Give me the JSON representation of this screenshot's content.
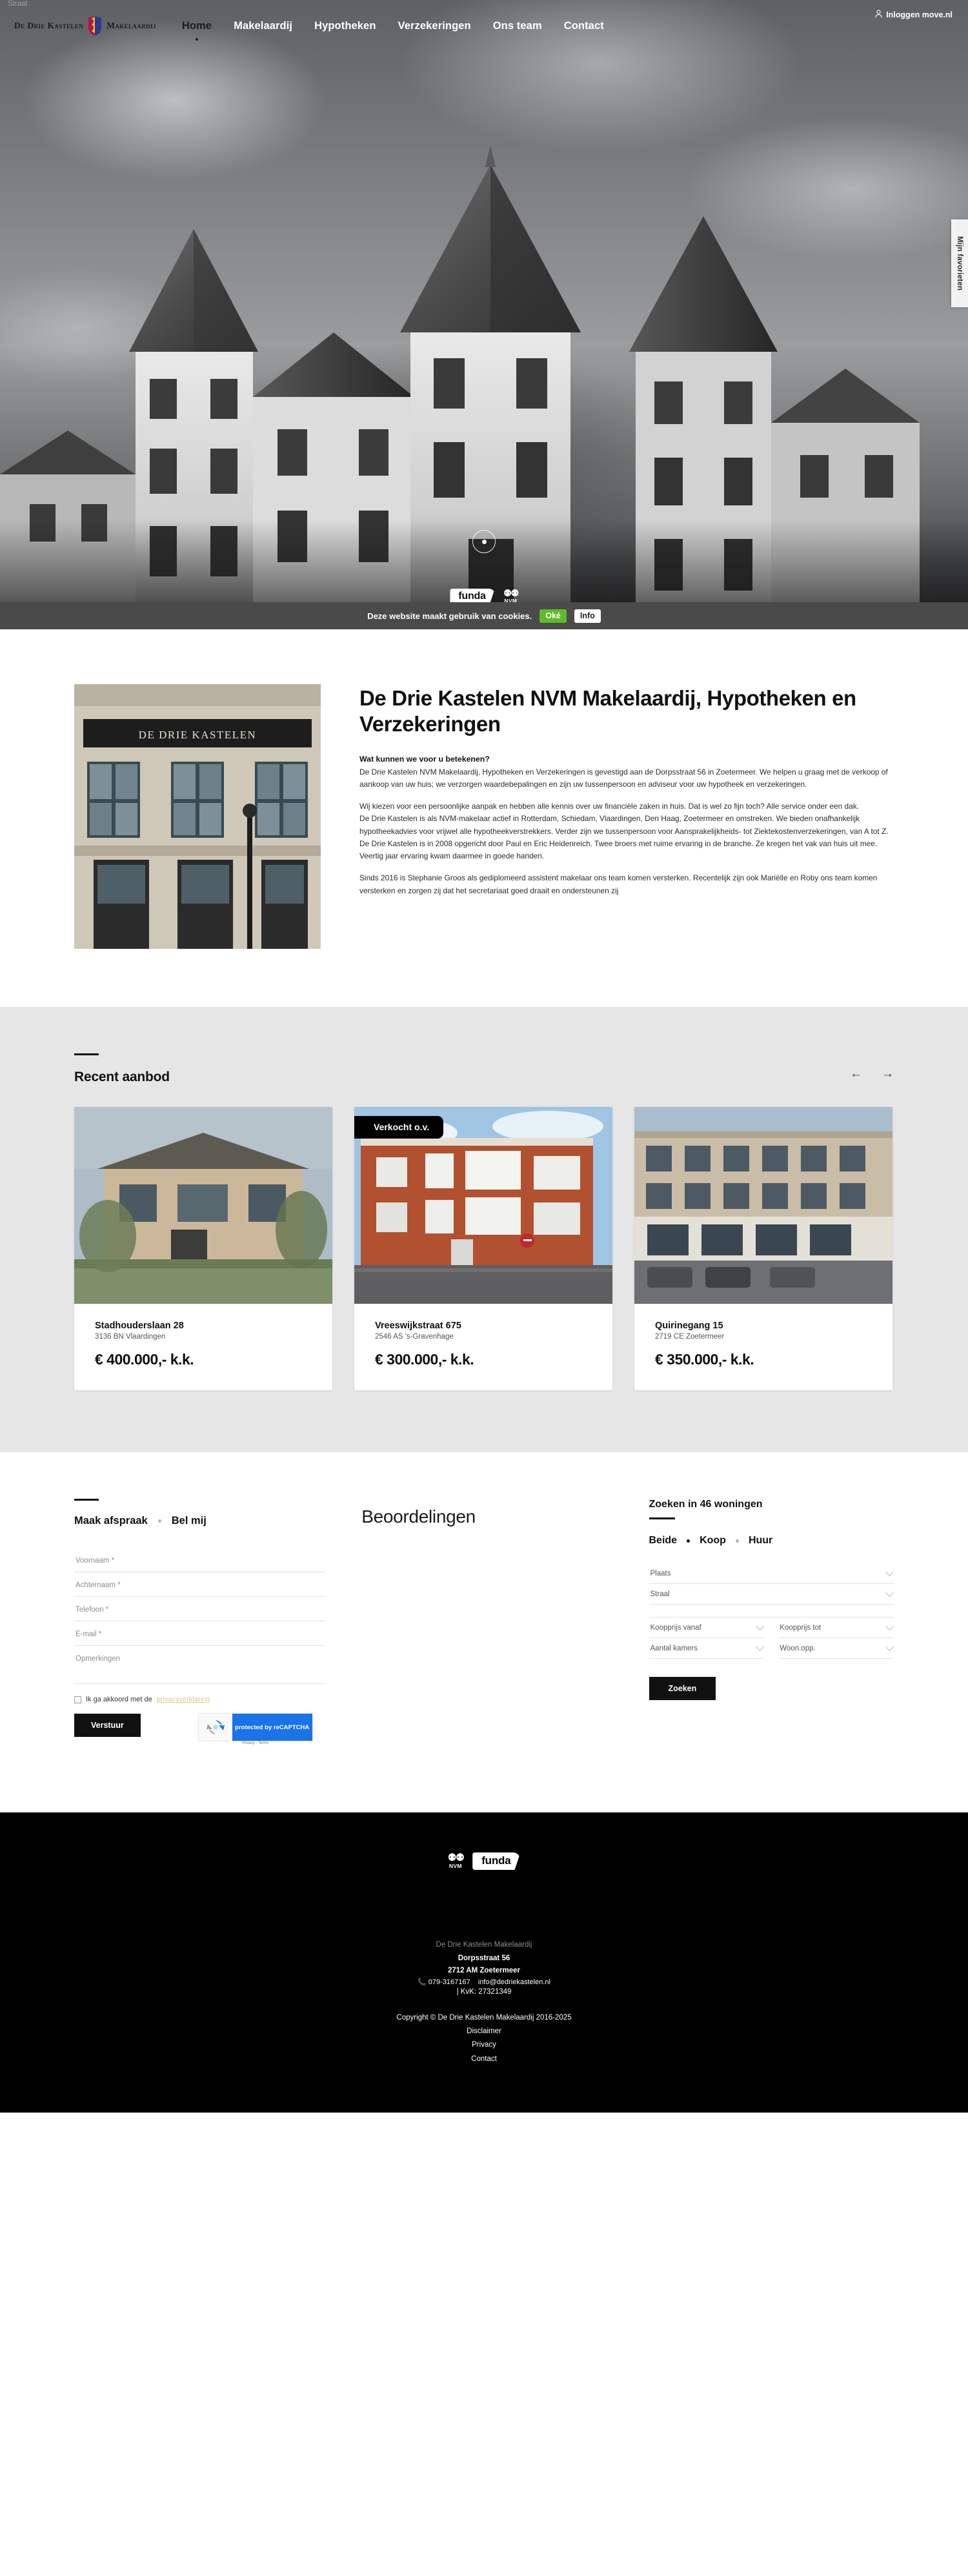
{
  "nav": {
    "logo_left": "De Drie Kastelen",
    "logo_right": "Makelaardij",
    "links": [
      {
        "label": "Home",
        "active": true
      },
      {
        "label": "Makelaardij",
        "active": false
      },
      {
        "label": "Hypotheken",
        "active": false
      },
      {
        "label": "Verzekeringen",
        "active": false
      },
      {
        "label": "Ons team",
        "active": false
      },
      {
        "label": "Contact",
        "active": false
      }
    ],
    "login_label": "Inloggen move.nl",
    "favorites_tab": "Mijn favorieten"
  },
  "hero": {
    "funda_badge": "funda",
    "nvm_badge": "NVM"
  },
  "cookie": {
    "message": "Deze website maakt gebruik van cookies.",
    "accept_label": "Oké",
    "info_label": "Info",
    "accept_color": "#5fbb27"
  },
  "about": {
    "title": "De Drie Kastelen NVM Makelaardij, Hypotheken en Verzekeringen",
    "lead": "Wat kunnen we voor u betekenen?",
    "paragraphs": [
      "De Drie Kastelen NVM Makelaardij, Hypotheken en Verzekeringen is gevestigd aan de Dorpsstraat 56 in Zoetermeer. We helpen u graag met de verkoop of aankoop van uw huis; we verzorgen waardebepalingen en zijn uw tussenpersoon en adviseur voor uw hypotheek en verzekeringen.",
      "Wij kiezen voor een persoonlijke aanpak en hebben alle kennis over uw financiële zaken in huis. Dat is wel zo fijn toch? Alle service onder een dak.\nDe Drie Kastelen is als NVM-makelaar actief in Rotterdam, Schiedam, Vlaardingen, Den Haag,  Zoetermeer en omstreken. We bieden onafhankelijk hypotheekadvies voor vrijwel alle hypotheekverstrekkers. Verder zijn we tussenpersoon voor Aansprakelijkheids-  tot Ziektekostenverzekeringen, van A tot Z.\nDe Drie Kastelen is in 2008 opgericht door Paul en Eric Heidenreich. Twee broers met ruime ervaring in de branche. Ze kregen het vak van huis uit mee. Veertig jaar ervaring kwam daarmee in goede handen.",
      "Sinds 2016 is Stephanie Groos als gediplomeerd assistent makelaar ons team komen versterken. Recentelijk zijn ook Mariëlle en Roby ons team komen versterken en zorgen zij dat het secretariaat goed draait en ondersteunen zij"
    ],
    "photo_sign": "DE DRIE KASTELEN"
  },
  "aanbod": {
    "title": "Recent aanbod",
    "prev_icon": "arrow-left-icon",
    "next_icon": "arrow-right-icon",
    "cards": [
      {
        "address": "Stadhouderslaan 28",
        "zip": "3136 BN Vlaardingen",
        "price": "€ 400.000,- k.k.",
        "badge": ""
      },
      {
        "address": "Vreeswijkstraat 675",
        "zip": "2546 AS 's-Gravenhage",
        "price": "€ 300.000,- k.k.",
        "badge": "Verkocht o.v."
      },
      {
        "address": "Quirinegang 15",
        "zip": "2719 CE Zoetermeer",
        "price": "€ 350.000,- k.k.",
        "badge": ""
      }
    ]
  },
  "contact": {
    "tab_appointment": "Maak afspraak",
    "tab_call": "Bel mij",
    "fields": [
      {
        "placeholder": "Voornaam *",
        "value": ""
      },
      {
        "placeholder": "Achternaam *",
        "value": ""
      },
      {
        "placeholder": "Telefoon *",
        "value": ""
      },
      {
        "placeholder": "E-mail *",
        "value": ""
      },
      {
        "placeholder": "Opmerkingen",
        "value": ""
      }
    ],
    "consent_text": "Ik ga akkoord met de",
    "consent_link": "privacyverklaring",
    "submit_label": "Verstuur",
    "recaptcha_label": "protected by reCAPTCHA",
    "recaptcha_footer": "Privacy - Terms"
  },
  "reviews": {
    "title": "Beoordelingen"
  },
  "search": {
    "title": "Zoeken in 46 woningen",
    "segments": [
      {
        "label": "Beide",
        "active": true
      },
      {
        "label": "Koop",
        "active": false
      },
      {
        "label": "Huur",
        "active": false
      }
    ],
    "selects": [
      {
        "label": "Plaats",
        "placeholder": false
      },
      {
        "label": "Straal",
        "placeholder": false
      },
      {
        "label": "Straat",
        "placeholder": true
      }
    ],
    "price_from": "Koopprijs vanaf",
    "price_to": "Koopprijs tot",
    "rooms": "Aantal kamers",
    "area": "Woon.opp.",
    "button": "Zoeken"
  },
  "footer": {
    "nvm": "NVM",
    "funda": "funda",
    "company": "De Drie Kastelen Makelaardij",
    "street": "Dorpsstraat 56",
    "city": "2712 AM Zoetermeer",
    "phone": "079-3167167",
    "email": "info@dedriekastelen.nl",
    "kvk": "| KvK: 27321349",
    "copyright": "Copyright © De Drie Kastelen Makelaardij 2016-2025",
    "links": [
      "Disclaimer",
      "Privacy",
      "Contact"
    ]
  }
}
